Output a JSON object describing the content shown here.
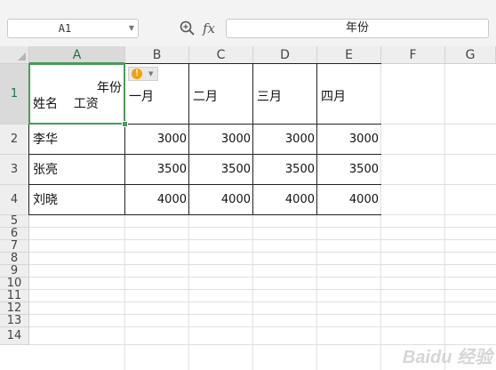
{
  "formula_bar": {
    "cell_ref": "A1",
    "fx_label": "fx",
    "formula_value": "年份"
  },
  "columns": [
    "A",
    "B",
    "C",
    "D",
    "E",
    "F",
    "G"
  ],
  "rows": [
    "1",
    "2",
    "3",
    "4",
    "5",
    "6",
    "7",
    "8",
    "9",
    "10",
    "11",
    "12",
    "13",
    "14"
  ],
  "selected_column": "A",
  "selected_row": "1",
  "header_cell": {
    "top_label": "年份",
    "bottom_label": "姓名    工资"
  },
  "months": [
    "一月",
    "二月",
    "三月",
    "四月"
  ],
  "records": [
    {
      "name": "李华",
      "values": [
        3000,
        3000,
        3000,
        3000
      ]
    },
    {
      "name": "张亮",
      "values": [
        3500,
        3500,
        3500,
        3500
      ]
    },
    {
      "name": "刘晓",
      "values": [
        4000,
        4000,
        4000,
        4000
      ]
    }
  ],
  "warning_icon": "!",
  "watermark": "Baidu 经验",
  "colors": {
    "selection": "#4a9b56",
    "warning": "#f0a30a"
  }
}
